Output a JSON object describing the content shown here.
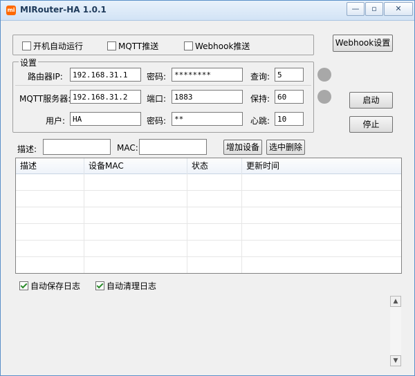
{
  "window": {
    "title": "MIRouter-HA 1.0.1",
    "icon_text": "mi",
    "minimize": "—",
    "maximize": "▫",
    "close": "✕"
  },
  "top_options": {
    "autostart": {
      "label": "开机自动运行",
      "checked": false
    },
    "mqtt_push": {
      "label": "MQTT推送",
      "checked": false
    },
    "webhook_push": {
      "label": "Webhook推送",
      "checked": false
    },
    "webhook_settings_button": "Webhook设置"
  },
  "settings": {
    "legend": "设置",
    "router_ip": {
      "label": "路由器IP:",
      "value": "192.168.31.1"
    },
    "router_password": {
      "label": "密码:",
      "value": "********"
    },
    "query_interval": {
      "label": "查询:",
      "value": "5"
    },
    "mqtt_server": {
      "label": "MQTT服务器:",
      "value": "192.168.31.2"
    },
    "mqtt_port": {
      "label": "端口:",
      "value": "1883"
    },
    "keepalive": {
      "label": "保持:",
      "value": "60"
    },
    "mqtt_user": {
      "label": "用户:",
      "value": "HA"
    },
    "mqtt_password": {
      "label": "密码:",
      "value": "**"
    },
    "heartbeat": {
      "label": "心跳:",
      "value": "10"
    }
  },
  "controls": {
    "start_button": "启动",
    "stop_button": "停止"
  },
  "device_form": {
    "desc_label": "描述:",
    "desc_value": "",
    "mac_label": "MAC:",
    "mac_value": "",
    "add_button": "增加设备",
    "delete_button": "选中删除"
  },
  "device_table": {
    "columns": [
      "描述",
      "设备MAC",
      "状态",
      "更新时间"
    ],
    "rows": []
  },
  "log_options": {
    "auto_save": {
      "label": "自动保存日志",
      "checked": true
    },
    "auto_clean": {
      "label": "自动清理日志",
      "checked": true
    }
  },
  "log_area": {
    "text": "",
    "scroll_up": "▲",
    "scroll_down": "▼"
  },
  "colors": {
    "accent": "#5a8fc8",
    "status_led": "#a8a8a8",
    "check": "#2a8a2a"
  }
}
